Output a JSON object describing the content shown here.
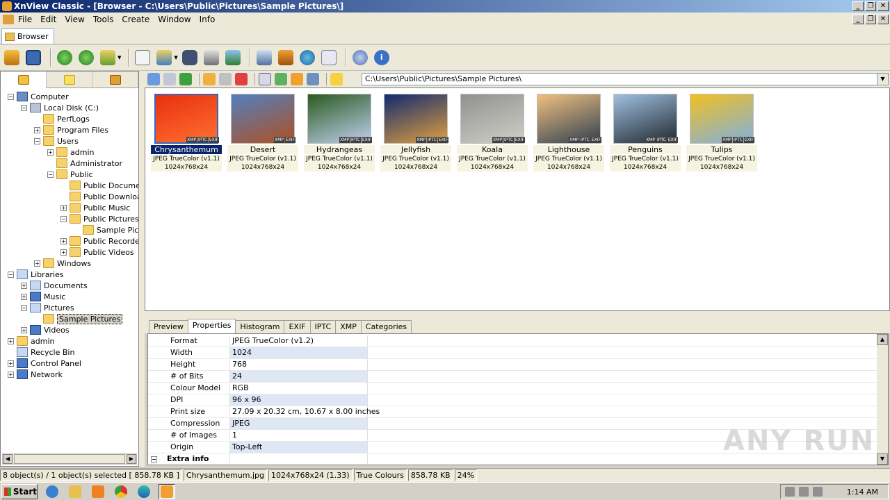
{
  "window": {
    "title": "XnView Classic - [Browser - C:\\Users\\Public\\Pictures\\Sample Pictures\\]"
  },
  "menu": [
    "File",
    "Edit",
    "View",
    "Tools",
    "Create",
    "Window",
    "Info"
  ],
  "tabs": {
    "browser": "Browser"
  },
  "path": "C:\\Users\\Public\\Pictures\\Sample Pictures\\",
  "tree": [
    {
      "label": "Computer",
      "icon": "computer-icon",
      "exp": "-"
    },
    {
      "label": "Local Disk (C:)",
      "icon": "drive-icon",
      "exp": "-"
    },
    {
      "label": "PerfLogs",
      "icon": "folder-icon",
      "exp": ""
    },
    {
      "label": "Program Files",
      "icon": "folder-icon",
      "exp": "+"
    },
    {
      "label": "Users",
      "icon": "folder-icon",
      "exp": "-"
    },
    {
      "label": "admin",
      "icon": "folder-icon",
      "exp": "+"
    },
    {
      "label": "Administrator",
      "icon": "folder-icon",
      "exp": ""
    },
    {
      "label": "Public",
      "icon": "folder-icon",
      "exp": "-"
    },
    {
      "label": "Public Documents",
      "icon": "folder-icon",
      "exp": ""
    },
    {
      "label": "Public Downloads",
      "icon": "folder-icon",
      "exp": ""
    },
    {
      "label": "Public Music",
      "icon": "folder-icon",
      "exp": "+"
    },
    {
      "label": "Public Pictures",
      "icon": "folder-icon",
      "exp": "-"
    },
    {
      "label": "Sample Pictures",
      "icon": "folder-icon",
      "exp": ""
    },
    {
      "label": "Public Recorded TV",
      "icon": "folder-icon",
      "exp": "+"
    },
    {
      "label": "Public Videos",
      "icon": "folder-icon",
      "exp": "+"
    },
    {
      "label": "Windows",
      "icon": "folder-icon",
      "exp": "+"
    },
    {
      "label": "Libraries",
      "icon": "library-icon",
      "exp": "-"
    },
    {
      "label": "Documents",
      "icon": "documents-icon",
      "exp": "+"
    },
    {
      "label": "Music",
      "icon": "music-icon",
      "exp": "+"
    },
    {
      "label": "Pictures",
      "icon": "pictures-icon",
      "exp": "-"
    },
    {
      "label": "Sample Pictures",
      "icon": "folder-icon",
      "exp": "",
      "selected": true
    },
    {
      "label": "Videos",
      "icon": "videos-icon",
      "exp": "+"
    },
    {
      "label": "admin",
      "icon": "user-folder-icon",
      "exp": "+"
    },
    {
      "label": "Recycle Bin",
      "icon": "recycle-bin-icon",
      "exp": ""
    },
    {
      "label": "Control Panel",
      "icon": "control-panel-icon",
      "exp": "+"
    },
    {
      "label": "Network",
      "icon": "network-icon",
      "exp": "+"
    }
  ],
  "thumbnails": [
    {
      "name": "Chrysanthemum",
      "format": "JPEG TrueColor (v1.1)",
      "dims": "1024x768x24",
      "badges": [
        "XMP",
        "IPTC",
        "EXIF"
      ],
      "colors": [
        "#e83010",
        "#ff7030"
      ],
      "selected": true
    },
    {
      "name": "Desert",
      "format": "JPEG TrueColor (v1.1)",
      "dims": "1024x768x24",
      "badges": [
        "XMP",
        "EXIF"
      ],
      "colors": [
        "#5080c0",
        "#b05020"
      ]
    },
    {
      "name": "Hydrangeas",
      "format": "JPEG TrueColor (v1.1)",
      "dims": "1024x768x24",
      "badges": [
        "XMP",
        "IPTC",
        "EXIF"
      ],
      "colors": [
        "#2a5a20",
        "#c0d0f0"
      ]
    },
    {
      "name": "Jellyfish",
      "format": "JPEG TrueColor (v1.1)",
      "dims": "1024x768x24",
      "badges": [
        "XMP",
        "IPTC",
        "EXIF"
      ],
      "colors": [
        "#102a70",
        "#e0a040"
      ]
    },
    {
      "name": "Koala",
      "format": "JPEG TrueColor (v1.1)",
      "dims": "1024x768x24",
      "badges": [
        "XMP",
        "IPTC",
        "EXIF"
      ],
      "colors": [
        "#909090",
        "#d0d0c8"
      ]
    },
    {
      "name": "Lighthouse",
      "format": "JPEG TrueColor (v1.1)",
      "dims": "1024x768x24",
      "badges": [
        "XMP",
        "IPTC",
        "EXIF"
      ],
      "colors": [
        "#f0c080",
        "#304050"
      ]
    },
    {
      "name": "Penguins",
      "format": "JPEG TrueColor (v1.1)",
      "dims": "1024x768x24",
      "badges": [
        "XMP",
        "IPTC",
        "EXIF"
      ],
      "colors": [
        "#a0c0e0",
        "#202830"
      ]
    },
    {
      "name": "Tulips",
      "format": "JPEG TrueColor (v1.1)",
      "dims": "1024x768x24",
      "badges": [
        "XMP",
        "IPTC",
        "EXIF"
      ],
      "colors": [
        "#f0c020",
        "#80b0e0"
      ]
    }
  ],
  "prop_tabs": [
    "Preview",
    "Properties",
    "Histogram",
    "EXIF",
    "IPTC",
    "XMP",
    "Categories"
  ],
  "properties": [
    {
      "key": "Format",
      "value": "JPEG TrueColor (v1.2)"
    },
    {
      "key": "Width",
      "value": "1024"
    },
    {
      "key": "Height",
      "value": "768"
    },
    {
      "key": "# of Bits",
      "value": "24"
    },
    {
      "key": "Colour Model",
      "value": "RGB"
    },
    {
      "key": "DPI",
      "value": "96 x 96"
    },
    {
      "key": "Print size",
      "value": "27.09 x 20.32 cm, 10.67 x 8.00 inches"
    },
    {
      "key": "Compression",
      "value": "JPEG"
    },
    {
      "key": "# of Images",
      "value": "1"
    },
    {
      "key": "Origin",
      "value": "Top-Left"
    }
  ],
  "extra_info": "Extra info",
  "status": [
    "8 object(s) / 1 object(s) selected  [ 858.78 KB ]",
    "Chrysanthemum.jpg",
    "1024x768x24 (1.33)",
    "True Colours",
    "858.78 KB",
    "24%"
  ],
  "taskbar": {
    "start": "Start",
    "clock": "1:14 AM"
  },
  "watermark": "ANY RUN"
}
